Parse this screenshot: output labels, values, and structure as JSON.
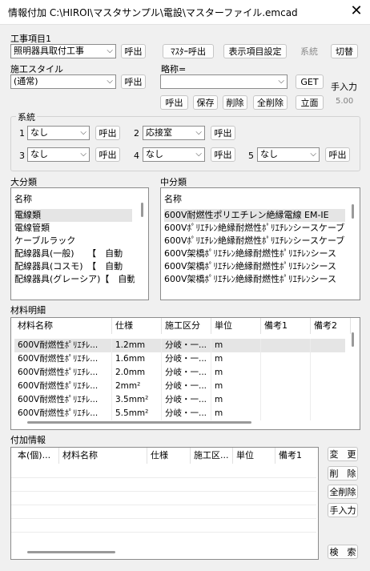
{
  "window": {
    "title": "情報付加 C:\\HIROI\\マスタサンプル\\電設\\マスターファイル.emcad",
    "close_glyph": "✕"
  },
  "work_item": {
    "label": "工事項目1",
    "value": "照明器具取付工事",
    "call_label": "呼出"
  },
  "top_buttons": {
    "master_call": "ﾏｽﾀｰ呼出",
    "display_settings": "表示項目設定",
    "system": "系統",
    "switch": "切替"
  },
  "construction_style": {
    "label": "施工スタイル",
    "value": "(通常)",
    "call_label": "呼出"
  },
  "abbreviation": {
    "label": "略称=",
    "value": "",
    "get_label": "GET"
  },
  "manual_input": {
    "label": "手入力",
    "value": "5.00"
  },
  "abbr_buttons": {
    "call": "呼出",
    "save": "保存",
    "delete": "削除",
    "delete_all": "全削除",
    "elevation": "立面"
  },
  "system_group": {
    "label": "系統",
    "call_label": "呼出",
    "slots": [
      {
        "num": "1",
        "value": "なし"
      },
      {
        "num": "2",
        "value": "応接室"
      },
      {
        "num": "3",
        "value": "なし"
      },
      {
        "num": "4",
        "value": "なし"
      },
      {
        "num": "5",
        "value": "なし"
      }
    ]
  },
  "major_category": {
    "label": "大分類",
    "header": "名称",
    "items": [
      "電線類",
      "電線管類",
      "ケーブルラック",
      "配線器具(一般)　　【　自動",
      "配線器具(コスモ)　【　自動",
      "配線器具(グレーシア)【　自動"
    ]
  },
  "middle_category": {
    "label": "中分類",
    "header": "名称",
    "items": [
      "600V耐燃性ポリエチレン絶縁電線 EM-IE",
      "600Vﾎﾟﾘｴﾁﾚﾝ絶縁耐燃性ﾎﾟﾘｴﾁﾚﾝシースケーブル",
      "600Vﾎﾟﾘｴﾁﾚﾝ絶縁耐燃性ﾎﾟﾘｴﾁﾚﾝシースケーブル",
      "600V架橋ﾎﾟﾘｴﾁﾚﾝ絶縁耐燃性ﾎﾟﾘｴﾁﾚﾝシース",
      "600V架橋ﾎﾟﾘｴﾁﾚﾝ絶縁耐燃性ﾎﾟﾘｴﾁﾚﾝシース",
      "600V架橋ﾎﾟﾘｴﾁﾚﾝ絶縁耐燃性ﾎﾟﾘｴﾁﾚﾝシース"
    ]
  },
  "material_detail": {
    "label": "材料明細",
    "columns": [
      "材料名称",
      "仕様",
      "施工区分",
      "単位",
      "備考1",
      "備考2"
    ],
    "rows": [
      [
        "600V耐燃性ﾎﾟﾘｴﾁﾚ...",
        "1.2mm",
        "分岐・一...",
        "m",
        "",
        ""
      ],
      [
        "600V耐燃性ﾎﾟﾘｴﾁﾚ...",
        "1.6mm",
        "分岐・一...",
        "m",
        "",
        ""
      ],
      [
        "600V耐燃性ﾎﾟﾘｴﾁﾚ...",
        "2.0mm",
        "分岐・一...",
        "m",
        "",
        ""
      ],
      [
        "600V耐燃性ﾎﾟﾘｴﾁﾚ...",
        "2mm²",
        "分岐・一...",
        "m",
        "",
        ""
      ],
      [
        "600V耐燃性ﾎﾟﾘｴﾁﾚ...",
        "3.5mm²",
        "分岐・一...",
        "m",
        "",
        ""
      ],
      [
        "600V耐燃性ﾎﾟﾘｴﾁﾚ...",
        "5.5mm²",
        "分岐・一...",
        "m",
        "",
        ""
      ]
    ]
  },
  "additional_info": {
    "label": "付加情報",
    "columns": [
      "本(個)...",
      "材料名称",
      "仕様",
      "施工区...",
      "単位",
      "備考1"
    ],
    "buttons": {
      "change": "変　更",
      "delete": "削　除",
      "delete_all": "全削除",
      "manual": "手入力",
      "search": "検　索"
    }
  },
  "colors": {
    "window_bg": "#f0f0f0",
    "list_bg": "#ffffff",
    "selection": "#e5e5e5"
  }
}
